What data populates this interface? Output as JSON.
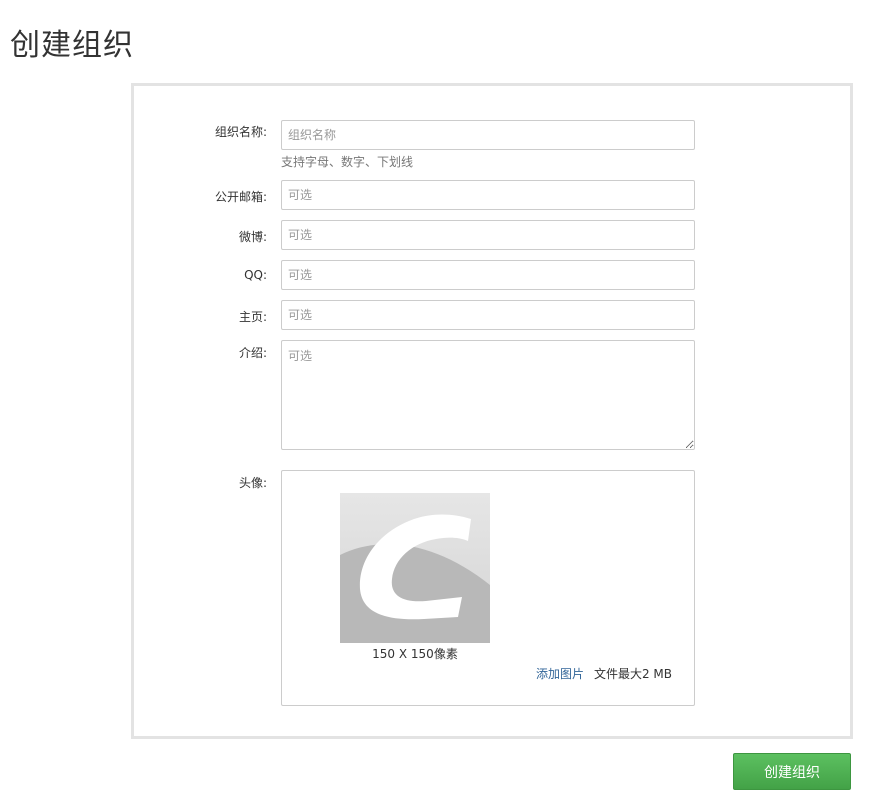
{
  "page": {
    "title": "创建组织"
  },
  "form": {
    "org_name": {
      "label": "组织名称:",
      "placeholder": "组织名称",
      "value": "",
      "help": "支持字母、数字、下划线"
    },
    "public_email": {
      "label": "公开邮箱:",
      "placeholder": "可选",
      "value": ""
    },
    "weibo": {
      "label": "微博:",
      "placeholder": "可选",
      "value": ""
    },
    "qq": {
      "label": "QQ:",
      "placeholder": "可选",
      "value": ""
    },
    "homepage": {
      "label": "主页:",
      "placeholder": "可选",
      "value": ""
    },
    "intro": {
      "label": "介绍:",
      "placeholder": "可选",
      "value": ""
    },
    "avatar": {
      "label": "头像:",
      "size_hint": "150 X 150像素",
      "add_label": "添加图片",
      "max_size": "文件最大2 MB"
    }
  },
  "submit": {
    "label": "创建组织"
  },
  "colors": {
    "submit_bg": "#4cae4f",
    "link": "#336699",
    "panel_border": "#e3e3e3"
  }
}
